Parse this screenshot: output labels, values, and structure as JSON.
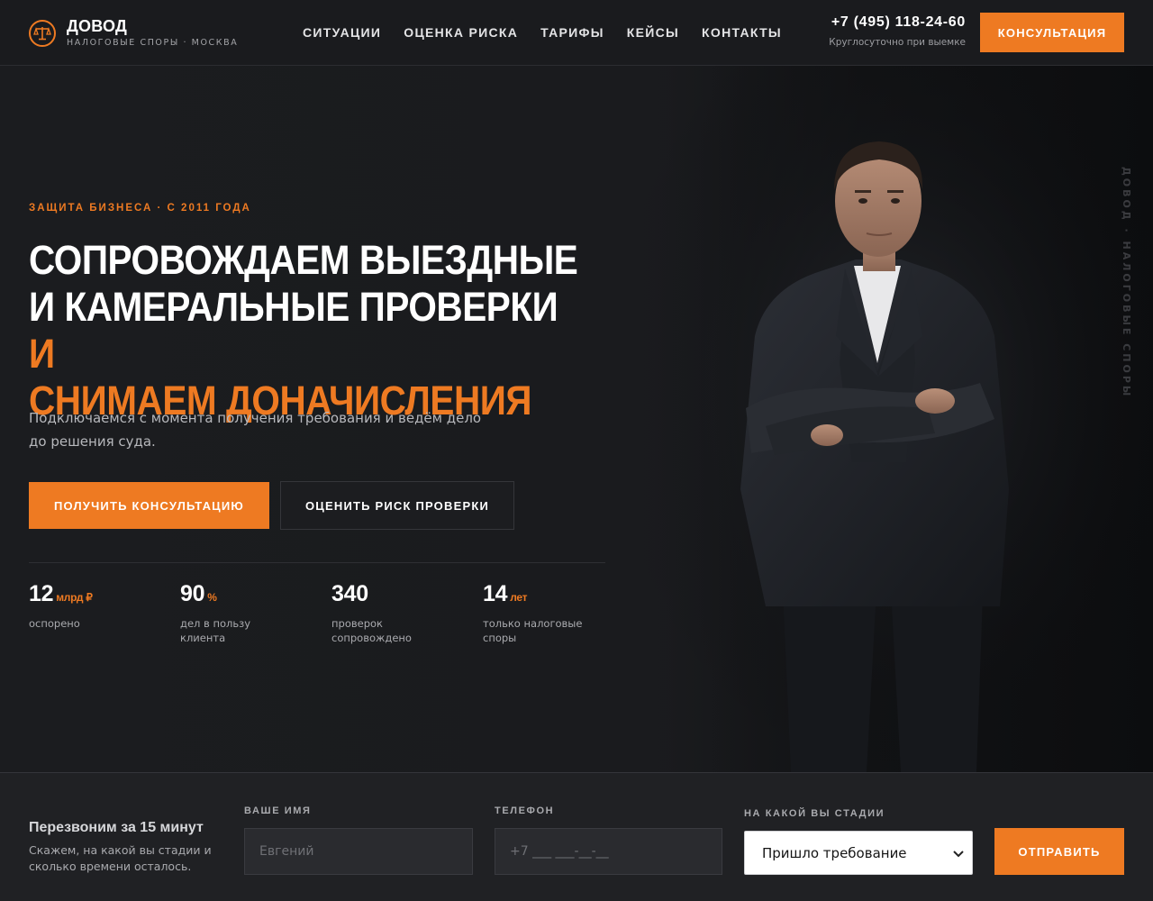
{
  "colors": {
    "accent": "#ee7a22",
    "background": "#18191c",
    "panel": "#202124"
  },
  "brand": {
    "logo_icon": "scales-icon",
    "name": "ДОВОД",
    "tagline": "НАЛОГОВЫЕ СПОРЫ · МОСКВА"
  },
  "nav": {
    "items": [
      {
        "label": "СИТУАЦИИ"
      },
      {
        "label": "ОЦЕНКА РИСКА"
      },
      {
        "label": "ТАРИФЫ"
      },
      {
        "label": "КЕЙСЫ"
      },
      {
        "label": "КОНТАКТЫ"
      }
    ]
  },
  "contact": {
    "phone": "+7 (495) 118-24-60",
    "note": "Круглосуточно при выемке",
    "cta_label": "КОНСУЛЬТАЦИЯ"
  },
  "hero": {
    "eyebrow": "ЗАЩИТА БИЗНЕСА · С 2011 ГОДА",
    "headline_line1": "СОПРОВОЖДАЕМ ВЫЕЗДНЫЕ",
    "headline_line2": "И КАМЕРАЛЬНЫЕ ПРОВЕРКИ",
    "headline_accent_inline": "И",
    "headline_accent_line": "СНИМАЕМ ДОНАЧИСЛЕНИЯ",
    "lead_line1": "Подключаемся с момента получения требования и ведём дело",
    "lead_line2": "до решения суда.",
    "primary_button": "ПОЛУЧИТЬ КОНСУЛЬТАЦИЮ",
    "secondary_button": "ОЦЕНИТЬ РИСК ПРОВЕРКИ",
    "side_caption": "ДОВОД · НАЛОГОВЫЕ СПОРЫ",
    "stats": [
      {
        "value": "12",
        "unit": "млрд ₽",
        "label": "оспорено"
      },
      {
        "value": "90",
        "unit": "%",
        "label": "дел в пользу клиента"
      },
      {
        "value": "340",
        "unit": "",
        "label": "проверок сопровождено"
      },
      {
        "value": "14",
        "unit": "лет",
        "label": "только налоговые споры"
      }
    ]
  },
  "callback": {
    "title": "Перезвоним за 15 минут",
    "text": "Скажем, на какой вы стадии и сколько времени осталось.",
    "name_label": "ВАШЕ ИМЯ",
    "name_placeholder": "Евгений",
    "phone_label": "ТЕЛЕФОН",
    "phone_placeholder": "+7 ___ ___-__-__",
    "stage_label": "НА КАКОЙ ВЫ СТАДИИ",
    "stage_selected": "Пришло требование",
    "submit_label": "ОТПРАВИТЬ"
  }
}
